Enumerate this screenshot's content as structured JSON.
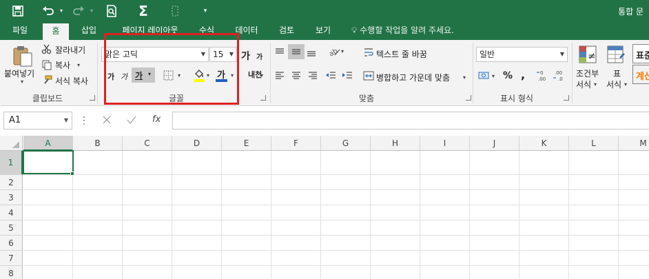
{
  "titlebar": {
    "app_title": "통합 문",
    "quick_access": [
      "save-icon",
      "undo-icon",
      "redo-icon",
      "print-preview-icon",
      "autosum-icon",
      "touch-mode-icon",
      "customize-icon"
    ],
    "sigma": "Σ"
  },
  "tabs": [
    "파일",
    "홈",
    "삽입",
    "페이지 레이아웃",
    "수식",
    "데이터",
    "검토",
    "보기"
  ],
  "tell_me": "수행할 작업을 알려 주세요.",
  "clipboard": {
    "paste": "붙여넣기",
    "cut": "잘라내기",
    "copy": "복사",
    "format_painter": "서식 복사",
    "label": "클립보드"
  },
  "font": {
    "name": "맑은 고딕",
    "size": "15",
    "grow": "가",
    "shrink": "가",
    "bold": "가",
    "italic": "가",
    "underline": "가",
    "font_color_glyph": "가",
    "highlight_color": "#ffff00",
    "font_color": "#1f5fbf",
    "label": "글꼴"
  },
  "alignment": {
    "wrap_text": "텍스트 줄 바꿈",
    "merge_center": "병합하고 가운데 맞춤",
    "label": "맞춤"
  },
  "number": {
    "format": "일반",
    "percent": "%",
    "comma": ",",
    "label": "표시 형식"
  },
  "styles": {
    "conditional_line1": "조건부",
    "conditional_line2": "서식",
    "table_line1": "표",
    "table_line2": "서식",
    "style_normal": "표준",
    "style_calc": "계산"
  },
  "formula_bar": {
    "name_box": "A1",
    "fx": "fx",
    "value": ""
  },
  "sheet": {
    "columns": [
      "A",
      "B",
      "C",
      "D",
      "E",
      "F",
      "G",
      "H",
      "I",
      "J",
      "K",
      "L",
      "M"
    ],
    "rows": [
      "1",
      "2",
      "3",
      "4",
      "5",
      "6",
      "7",
      "8"
    ],
    "active_cell": "A1"
  },
  "colors": {
    "accent": "#217346",
    "annotation": "#e02020"
  }
}
